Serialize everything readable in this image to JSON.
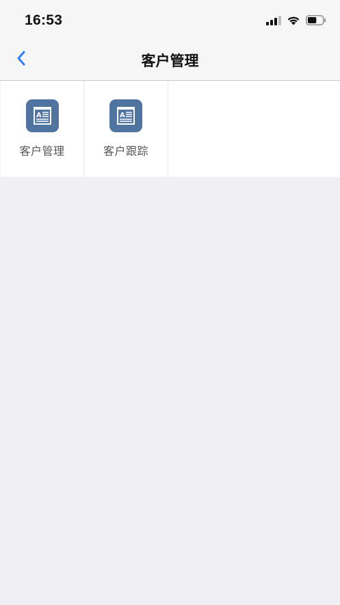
{
  "status_bar": {
    "time": "16:53",
    "icons": [
      "signal-icon",
      "wifi-icon",
      "battery-icon"
    ],
    "battery_level": 0.6
  },
  "nav": {
    "back_icon": "chevron-left-icon",
    "title": "客户管理"
  },
  "grid": {
    "items": [
      {
        "label": "客户管理",
        "icon": "document-icon"
      },
      {
        "label": "客户跟踪",
        "icon": "document-icon"
      }
    ]
  },
  "colors": {
    "accent": "#2f7cf6",
    "icon_bg": "#4f74a0",
    "page_bg": "#efeff4",
    "bar_bg": "#f6f6f6"
  }
}
